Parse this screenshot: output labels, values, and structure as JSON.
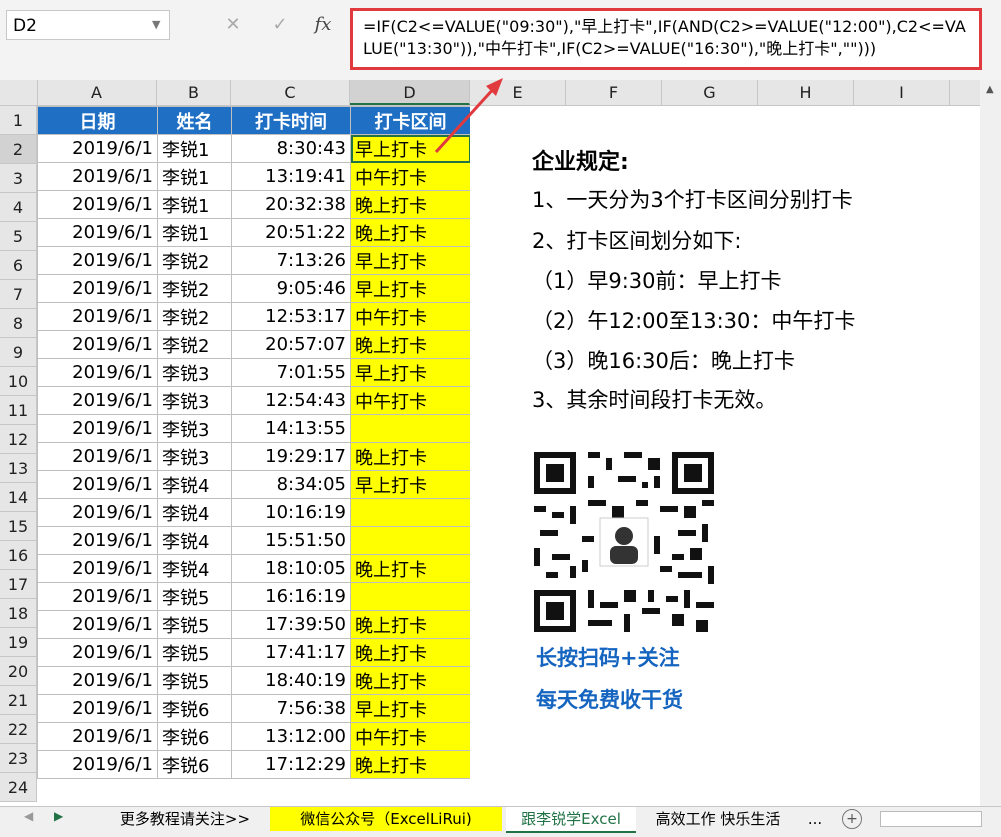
{
  "namebox": {
    "value": "D2"
  },
  "formula_bar": {
    "cancel_icon": "✕",
    "enter_icon": "✓",
    "fx_label": "fx",
    "formula": "=IF(C2<=VALUE(\"09:30\"),\"早上打卡\",IF(AND(C2>=VALUE(\"12:00\"),C2<=VALUE(\"13:30\")),\"中午打卡\",IF(C2>=VALUE(\"16:30\"),\"晚上打卡\",\"\")))"
  },
  "columns": [
    "A",
    "B",
    "C",
    "D",
    "E",
    "F",
    "G",
    "H",
    "I"
  ],
  "row_numbers": [
    "1",
    "2",
    "3",
    "4",
    "5",
    "6",
    "7",
    "8",
    "9",
    "10",
    "11",
    "12",
    "13",
    "14",
    "15",
    "16",
    "17",
    "18",
    "19",
    "20",
    "21",
    "22",
    "23",
    "24"
  ],
  "table": {
    "headers": [
      "日期",
      "姓名",
      "打卡时间",
      "打卡区间"
    ],
    "rows": [
      [
        "2019/6/1",
        "李锐1",
        "8:30:43",
        "早上打卡"
      ],
      [
        "2019/6/1",
        "李锐1",
        "13:19:41",
        "中午打卡"
      ],
      [
        "2019/6/1",
        "李锐1",
        "20:32:38",
        "晚上打卡"
      ],
      [
        "2019/6/1",
        "李锐1",
        "20:51:22",
        "晚上打卡"
      ],
      [
        "2019/6/1",
        "李锐2",
        "7:13:26",
        "早上打卡"
      ],
      [
        "2019/6/1",
        "李锐2",
        "9:05:46",
        "早上打卡"
      ],
      [
        "2019/6/1",
        "李锐2",
        "12:53:17",
        "中午打卡"
      ],
      [
        "2019/6/1",
        "李锐2",
        "20:57:07",
        "晚上打卡"
      ],
      [
        "2019/6/1",
        "李锐3",
        "7:01:55",
        "早上打卡"
      ],
      [
        "2019/6/1",
        "李锐3",
        "12:54:43",
        "中午打卡"
      ],
      [
        "2019/6/1",
        "李锐3",
        "14:13:55",
        ""
      ],
      [
        "2019/6/1",
        "李锐3",
        "19:29:17",
        "晚上打卡"
      ],
      [
        "2019/6/1",
        "李锐4",
        "8:34:05",
        "早上打卡"
      ],
      [
        "2019/6/1",
        "李锐4",
        "10:16:19",
        ""
      ],
      [
        "2019/6/1",
        "李锐4",
        "15:51:50",
        ""
      ],
      [
        "2019/6/1",
        "李锐4",
        "18:10:05",
        "晚上打卡"
      ],
      [
        "2019/6/1",
        "李锐5",
        "16:16:19",
        ""
      ],
      [
        "2019/6/1",
        "李锐5",
        "17:39:50",
        "晚上打卡"
      ],
      [
        "2019/6/1",
        "李锐5",
        "17:41:17",
        "晚上打卡"
      ],
      [
        "2019/6/1",
        "李锐5",
        "18:40:19",
        "晚上打卡"
      ],
      [
        "2019/6/1",
        "李锐6",
        "7:56:38",
        "早上打卡"
      ],
      [
        "2019/6/1",
        "李锐6",
        "13:12:00",
        "中午打卡"
      ],
      [
        "2019/6/1",
        "李锐6",
        "17:12:29",
        "晚上打卡"
      ]
    ]
  },
  "panel": {
    "title": "企业规定:",
    "lines": [
      "1、一天分为3个打卡区间分别打卡",
      "2、打卡区间划分如下:",
      "（1）早9:30前：早上打卡",
      "（2）午12:00至13:30：中午打卡",
      "（3）晚16:30后：晚上打卡",
      "3、其余时间段打卡无效。"
    ],
    "qr_icon": "qr-code-icon",
    "promo1": "长按扫码+关注",
    "promo2": "每天免费收干货"
  },
  "sheet_tabs": [
    "更多教程请关注>>",
    "微信公众号（ExcelLiRui)",
    "跟李锐学Excel",
    "高效工作 快乐生活",
    "..."
  ],
  "colors": {
    "header_blue": "#1f6fc5",
    "highlight_yellow": "#ffff00",
    "annotation_red": "#e0393e",
    "promo_blue": "#1565c0",
    "excel_green": "#217346"
  }
}
